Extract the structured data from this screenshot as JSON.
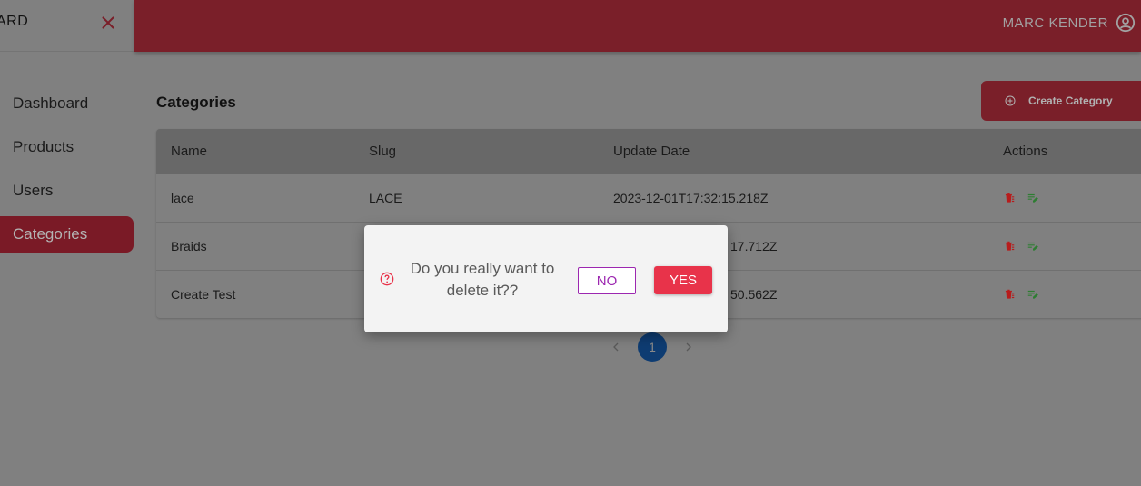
{
  "colors": {
    "accent": "#7a1f29",
    "danger": "#e8334a",
    "no_button": "#9c27b0",
    "pager_active": "#0e3c72",
    "delete_icon": "#b71c1c",
    "edit_icon": "#2e7d32"
  },
  "sidebar": {
    "brand": "ARD",
    "close_icon": "close-icon",
    "items": [
      {
        "label": "Dashboard",
        "active": false
      },
      {
        "label": "Products",
        "active": false
      },
      {
        "label": "Users",
        "active": false
      },
      {
        "label": "Categories",
        "active": true
      }
    ]
  },
  "header": {
    "user_name": "MARC KENDER",
    "user_icon": "account-circle-icon"
  },
  "main": {
    "title": "Categories",
    "create_button": "Create Category",
    "create_icon": "add-circle-icon"
  },
  "table": {
    "columns": [
      "Name",
      "Slug",
      "Update Date",
      "Actions"
    ],
    "rows": [
      {
        "name": "lace",
        "slug": "LACE",
        "date": "2023-12-01T17:32:15.218Z"
      },
      {
        "name": "Braids",
        "slug": "",
        "date": "17.712Z"
      },
      {
        "name": "Create Test",
        "slug": "",
        "date": "50.562Z"
      }
    ],
    "actions": [
      "delete-icon",
      "edit-icon"
    ]
  },
  "pagination": {
    "current": "1"
  },
  "dialog": {
    "message": "Do you really want to delete it??",
    "no_label": "NO",
    "yes_label": "YES",
    "icon": "help-circle-icon"
  }
}
